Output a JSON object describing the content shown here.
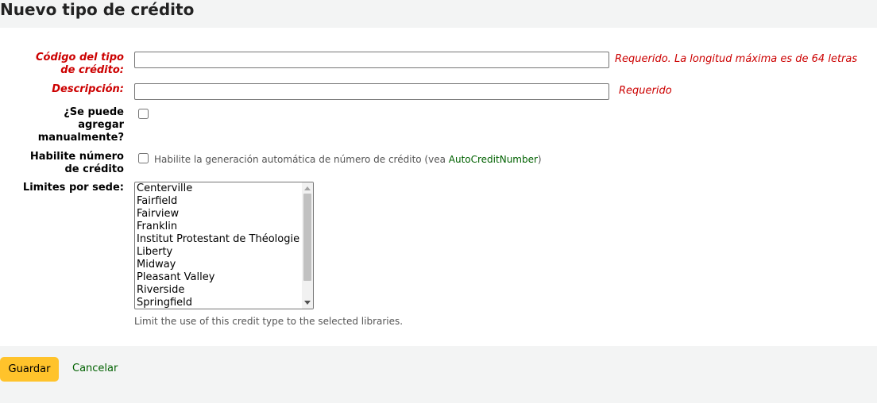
{
  "page": {
    "title": "Nuevo tipo de crédito"
  },
  "form": {
    "code": {
      "label_line1": "Código del tipo",
      "label_line2": "de crédito:",
      "value": "",
      "required_hint": "Requerido. La longitud máxima es de 64 letras"
    },
    "description": {
      "label": "Descripción:",
      "value": "",
      "required_hint": "Requerido"
    },
    "can_add_manually": {
      "label_line1": "¿Se puede",
      "label_line2": "agregar",
      "label_line3": "manualmente?",
      "checked": false
    },
    "credit_number": {
      "label_line1": "Habilite número",
      "label_line2": "de crédito",
      "checked": false,
      "hint_prefix": "Habilite la generación automática de número de crédito (vea ",
      "hint_link": "AutoCreditNumber",
      "hint_suffix": ")"
    },
    "library_limits": {
      "label": "Limites por sede:",
      "options": [
        "Centerville",
        "Fairfield",
        "Fairview",
        "Franklin",
        "Institut Protestant de Théologie",
        "Liberty",
        "Midway",
        "Pleasant Valley",
        "Riverside",
        "Springfield"
      ],
      "hint": "Limit the use of this credit type to the selected libraries."
    }
  },
  "actions": {
    "save_label": "Guardar",
    "cancel_label": "Cancelar",
    "save_color": "#ffc32b",
    "link_color": "#006100"
  },
  "colors": {
    "required": "#cc0000",
    "background": "#f3f4f4"
  }
}
